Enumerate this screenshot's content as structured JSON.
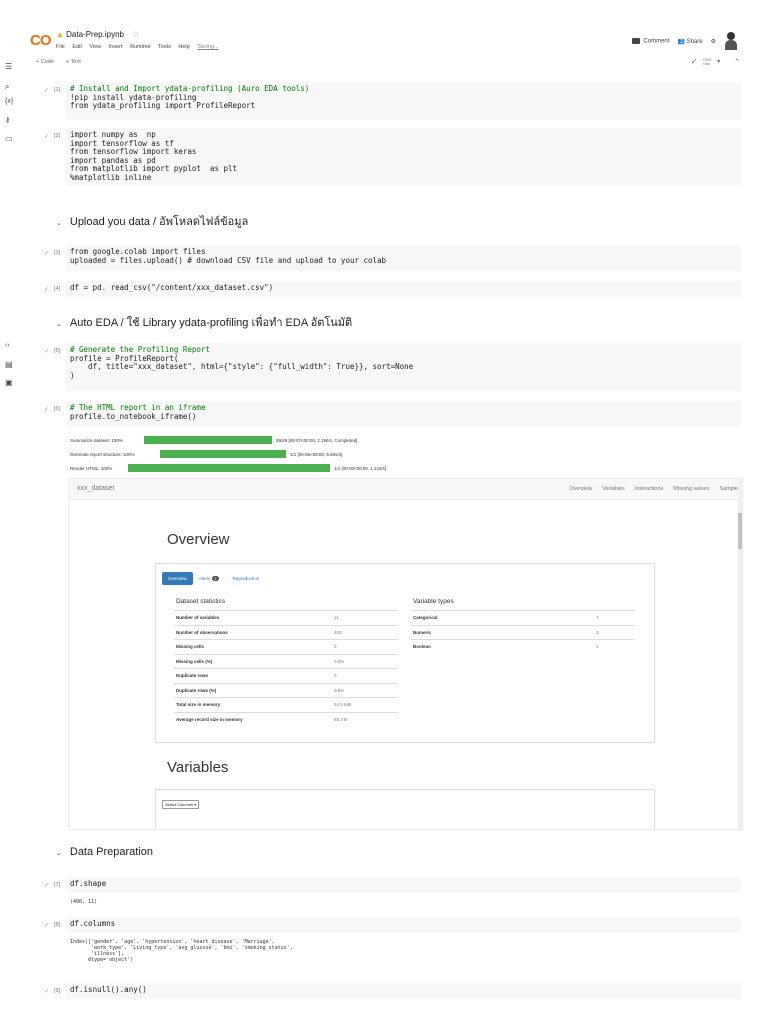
{
  "header": {
    "logo": "CO",
    "notebook_title": "Data-Prep.ipynb",
    "menu": [
      "File",
      "Edit",
      "View",
      "Insert",
      "Runtime",
      "Tools",
      "Help"
    ],
    "save_status": "Saving...",
    "comment": "Comment",
    "share": "Share"
  },
  "toolbar": {
    "add_code": "+ Code",
    "add_text": "+ Text",
    "ram": "RAM",
    "disk": "Disk"
  },
  "cells": {
    "c1": {
      "count": "[1]",
      "lines": [
        "# Install and Import ydata-profiling (Auro EDA tools)",
        "!pip install ydata-profiling",
        "from ydata_profiling import ProfileReport"
      ]
    },
    "c2": {
      "count": "[2]",
      "lines": [
        "import numpy as  np",
        "import tensorflow as tf",
        "from tensorflow import keras",
        "import pandas as pd",
        "from matplotlib import pyplot  as plt",
        "%matplotlib inline"
      ]
    },
    "c3": {
      "count": "[3]",
      "lines": [
        "from google.colab import files",
        "uploaded = files.upload() # download CSV file and upload to your colab"
      ]
    },
    "c4": {
      "count": "[4]",
      "code": "df = pd. read_csv(\"/content/xxx_dataset.csv\")"
    },
    "c5": {
      "count": "[5]",
      "lines": [
        "# Generate the Profiling Report",
        "profile = ProfileReport(",
        "    df, title=\"xxx_dataset\", html={\"style\": {\"full_width\": True}}, sort=None",
        ")"
      ]
    },
    "c6": {
      "count": "[6]",
      "lines": [
        "# The HTML report in an iframe",
        "profile.to_notebook_iframe()"
      ]
    },
    "c7": {
      "count": "[7]",
      "code": "df.shape",
      "output": "(400, 11)"
    },
    "c8": {
      "count": "[8]",
      "code": "df.columns",
      "output": "Index(['gender', 'age', 'hypertension', 'heart_disease', 'Marriage',\n       'work_type', 'Living_type', 'avg_glucose', 'bmi', 'smoking_status',\n       'illness'],\n      dtype='object')"
    },
    "c9": {
      "count": "[9]",
      "code": "df.isnull().any()"
    }
  },
  "sections": {
    "upload": "Upload you data / อัพโหลดไฟล์ข้อมูล",
    "auto_eda": "Auto EDA / ใช้ Library ydata-profiling เพื่อทำ EDA อัตโนมัติ",
    "prep": "Data Preparation"
  },
  "progress": [
    {
      "label": "Summarize dataset: 100%",
      "fraction": 1.0,
      "detail": "29/29 [00:07<00:00,  2.19it/s, Completed]"
    },
    {
      "label": "Generate report structure: 100%",
      "fraction": 1.0,
      "detail": "1/1 [00:05<00:00,  5.50s/it]"
    },
    {
      "label": "Render HTML: 100%",
      "fraction": 1.0,
      "detail": "1/1 [00:00<00:00,  1.21it/s]"
    }
  ],
  "report": {
    "brand": "xxx_dataset",
    "nav": [
      "Overview",
      "Variables",
      "Interactions",
      "Missing values",
      "Sample"
    ],
    "overview_title": "Overview",
    "tabs": {
      "overview": "Overview",
      "alerts": "Alerts",
      "alerts_count": "1",
      "reproduction": "Reproduction"
    },
    "dataset_statistics_title": "Dataset statistics",
    "dataset_statistics": [
      {
        "k": "Number of variables",
        "v": "11"
      },
      {
        "k": "Number of observations",
        "v": "400"
      },
      {
        "k": "Missing cells",
        "v": "0"
      },
      {
        "k": "Missing cells (%)",
        "v": "0.0%"
      },
      {
        "k": "Duplicate rows",
        "v": "0"
      },
      {
        "k": "Duplicate rows (%)",
        "v": "0.0%"
      },
      {
        "k": "Total size in memory",
        "v": "34.5 KiB"
      },
      {
        "k": "Average record size in memory",
        "v": "88.3 B"
      }
    ],
    "variable_types_title": "Variable types",
    "variable_types": [
      {
        "k": "Categorical",
        "v": "7"
      },
      {
        "k": "Numeric",
        "v": "3"
      },
      {
        "k": "Boolean",
        "v": "1"
      }
    ],
    "variables_title": "Variables",
    "select_columns": "Select Columns"
  }
}
